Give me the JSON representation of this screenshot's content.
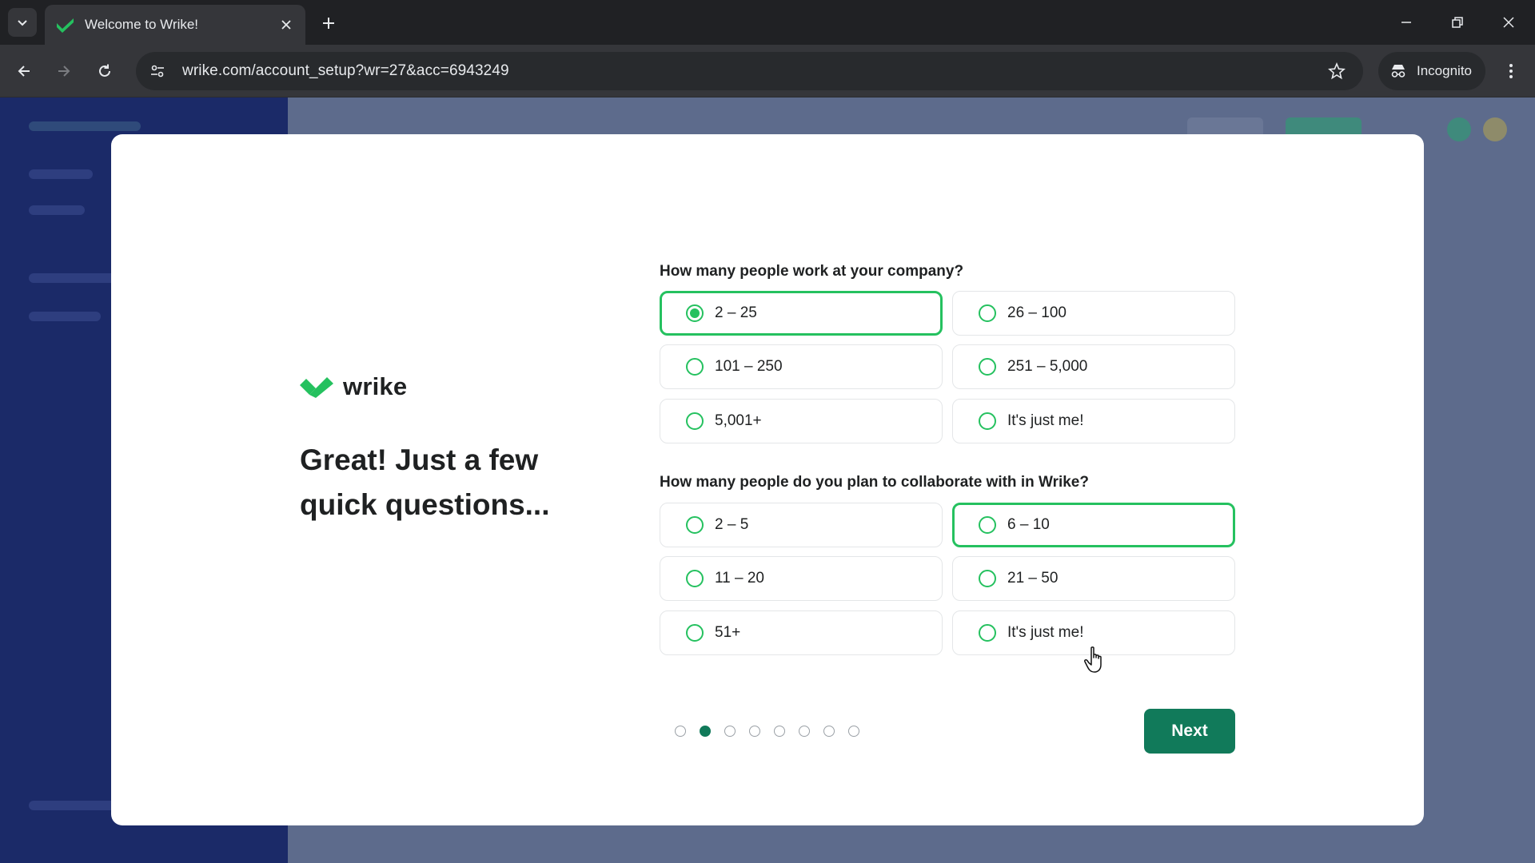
{
  "browser": {
    "tab_title": "Welcome to Wrike!",
    "url": "wrike.com/account_setup?wr=27&acc=6943249",
    "incognito_label": "Incognito"
  },
  "modal": {
    "logo_text": "wrike",
    "headline": "Great! Just a few quick questions...",
    "question1": {
      "label": "How many people work at your company?",
      "options": [
        "2 – 25",
        "26 – 100",
        "101 – 250",
        "251 – 5,000",
        "5,001+",
        "It's just me!"
      ],
      "selected": "2 – 25"
    },
    "question2": {
      "label": "How many people do you plan to collaborate with in Wrike?",
      "options": [
        "2 – 5",
        "6 – 10",
        "11 – 20",
        "21 – 50",
        "51+",
        "It's just me!"
      ],
      "highlighted": "6 – 10"
    },
    "progress": {
      "total_steps": 8,
      "current_step": 2
    },
    "next_label": "Next"
  },
  "colors": {
    "brand_green": "#25c15f",
    "button_green": "#117a5a",
    "backdrop": "#5d6b8c",
    "sidebar": "#1b2a68"
  }
}
